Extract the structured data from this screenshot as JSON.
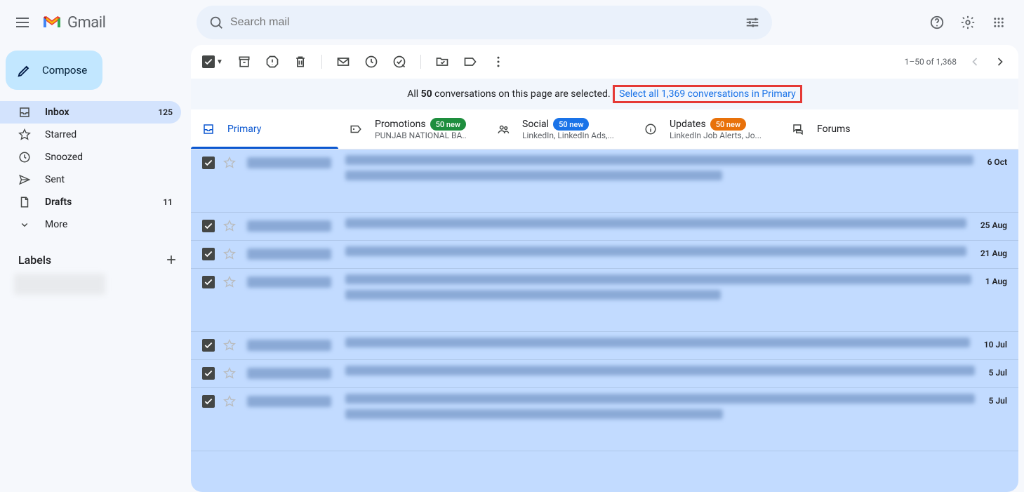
{
  "header": {
    "logo_text": "Gmail",
    "search_placeholder": "Search mail"
  },
  "compose_label": "Compose",
  "nav": [
    {
      "icon": "inbox",
      "label": "Inbox",
      "count": "125",
      "active": true,
      "bold": true
    },
    {
      "icon": "star",
      "label": "Starred",
      "count": "",
      "active": false,
      "bold": false
    },
    {
      "icon": "clock",
      "label": "Snoozed",
      "count": "",
      "active": false,
      "bold": false
    },
    {
      "icon": "send",
      "label": "Sent",
      "count": "",
      "active": false,
      "bold": false
    },
    {
      "icon": "file",
      "label": "Drafts",
      "count": "11",
      "active": false,
      "bold": true
    },
    {
      "icon": "chevron-down",
      "label": "More",
      "count": "",
      "active": false,
      "bold": false
    }
  ],
  "labels_header": "Labels",
  "toolbar": {
    "page_info": "1–50 of 1,368"
  },
  "banner": {
    "prefix": "All ",
    "bold1": "50",
    "mid": " conversations on this page are selected. ",
    "link": "Select all 1,369 conversations in Primary"
  },
  "tabs": [
    {
      "icon": "inbox",
      "label": "Primary",
      "badge": "",
      "badge_color": "",
      "sub": "",
      "active": true
    },
    {
      "icon": "tag",
      "label": "Promotions",
      "badge": "50 new",
      "badge_color": "green",
      "sub": "PUNJAB NATIONAL BA..",
      "active": false
    },
    {
      "icon": "people",
      "label": "Social",
      "badge": "50 new",
      "badge_color": "blue",
      "sub": "LinkedIn, LinkedIn Ads,...",
      "active": false
    },
    {
      "icon": "info",
      "label": "Updates",
      "badge": "50 new",
      "badge_color": "orange",
      "sub": "LinkedIn Job Alerts, Jo...",
      "active": false
    },
    {
      "icon": "forum",
      "label": "Forums",
      "badge": "",
      "badge_color": "",
      "sub": "",
      "active": false
    }
  ],
  "emails": [
    {
      "date": "6 Oct",
      "tall": true
    },
    {
      "date": "25 Aug",
      "tall": false
    },
    {
      "date": "21 Aug",
      "tall": false
    },
    {
      "date": "1 Aug",
      "tall": true
    },
    {
      "date": "10 Jul",
      "tall": false
    },
    {
      "date": "5 Jul",
      "tall": false
    },
    {
      "date": "5 Jul",
      "tall": true
    }
  ]
}
